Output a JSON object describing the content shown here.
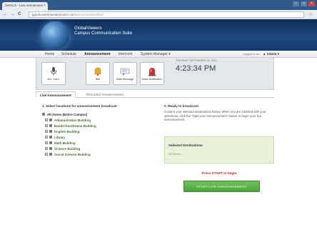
{
  "browser": {
    "tab_title": "SHOCS - Live Announcem",
    "tab_close": "×",
    "win_min": "–",
    "win_max": "□",
    "win_close": "×",
    "url_host": "grjcds.extremeclassroom.com",
    "url_path": "/announcement/live/",
    "back": "←",
    "forward": "→",
    "reload": "C",
    "star": "☆"
  },
  "app": {
    "brand_line1": "GlobalViewers",
    "brand_line2": "Campus Communication Suite"
  },
  "nav": {
    "items": [
      "Home",
      "Schedule",
      "Announcement",
      "Intercom",
      "System Manager ▾"
    ],
    "active": "Announcement",
    "logged_in_as": "Logged in as",
    "user": "▲ Admin ▾"
  },
  "tools": [
    {
      "label": "ALL CALL",
      "icon": "microphone-icon"
    },
    {
      "label": "Bell",
      "icon": "bell-icon"
    },
    {
      "label": "Data Message",
      "icon": "message-icon"
    },
    {
      "label": "Mass Notification",
      "icon": "siren-icon"
    }
  ],
  "clock": {
    "date": "TUESDAY, SEPTEMBER 13, 2011",
    "time": "4:23:34 PM"
  },
  "content_tabs": [
    "Live Announcement",
    "Recorded Announcement"
  ],
  "step1": {
    "heading": "1. Select locations for announcement broadcast",
    "root": "All Zones (Entire Campus)",
    "items": [
      "Administration Building",
      "Band/Choir/Drama Building",
      "English Building",
      "Library",
      "Math Building",
      "Science Building",
      "Social Science Building"
    ]
  },
  "step2": {
    "heading": "2. Ready to broadcast",
    "instructions": "Confirm your selected destinations below. When you are satisfied with your selections, click the \"Start Live Announcement\" button to begin your live announcement.",
    "dest_title": "Selected Destinations",
    "dest_value": "All Zones",
    "press_start": "Press START to begin",
    "start_button": "START LIVE ANNOUNCEMENT"
  }
}
